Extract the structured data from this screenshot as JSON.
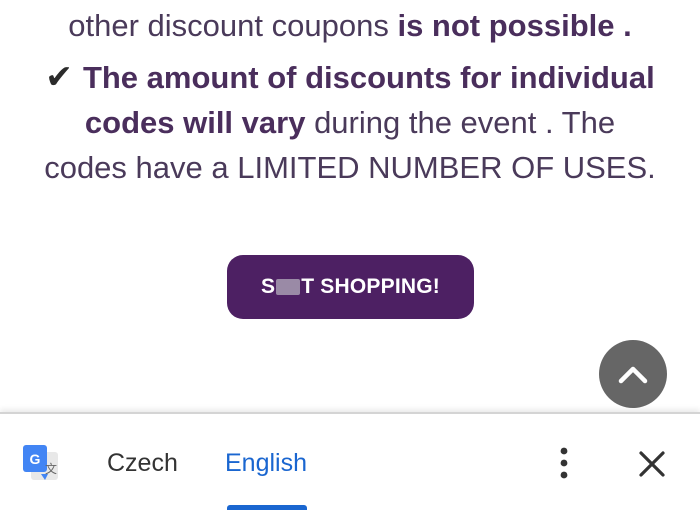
{
  "content": {
    "line1_plain": "other discount coupons ",
    "line1_bold": "is not possible .",
    "line2_bold": "The amount of discounts for individual",
    "line3_bold": "codes will vary",
    "line3_plain": " during the event . The",
    "line4_plain": "codes have a LIMITED NUMBER OF USES.",
    "check_glyph": "✔"
  },
  "shop_button": {
    "label_start": "S",
    "label_end": "T SHOPPING!"
  },
  "translate_bar": {
    "source_language": "Czech",
    "target_language": "English",
    "selected": "English"
  },
  "colors": {
    "text": "#4a3a5a",
    "button_bg": "#4d2063",
    "accent_blue": "#1a66d0",
    "scroll_button": "#666666"
  },
  "icons": {
    "check": "check-icon",
    "scroll_top": "chevron-up-icon",
    "translate": "google-translate-icon",
    "menu": "more-vert-icon",
    "close": "close-icon"
  }
}
